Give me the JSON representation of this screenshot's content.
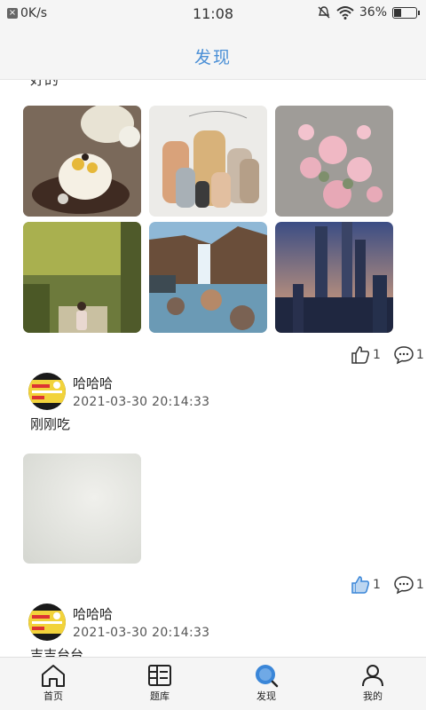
{
  "status_bar": {
    "speed": "0K/s",
    "time": "11:08",
    "battery": "36%",
    "battery_level": 0.36
  },
  "header": {
    "title": "发现"
  },
  "feed": {
    "partial_text": "好的",
    "post1": {
      "likes": "1",
      "comments": "1"
    },
    "post2": {
      "username": "哈哈哈",
      "timestamp": "2021-03-30 20:14:33",
      "text": "刚刚吃",
      "likes": "1",
      "comments": "1"
    },
    "post3": {
      "username": "哈哈哈",
      "timestamp": "2021-03-30 20:14:33",
      "text": "吉吉台台"
    }
  },
  "tabbar": {
    "items": [
      {
        "label": "首页",
        "icon": "home-icon"
      },
      {
        "label": "题库",
        "icon": "library-icon"
      },
      {
        "label": "发现",
        "icon": "discover-icon",
        "active": true
      },
      {
        "label": "我的",
        "icon": "profile-icon"
      }
    ],
    "active_color": "#3a86d8"
  },
  "colors": {
    "accent": "#4a8fd6"
  }
}
